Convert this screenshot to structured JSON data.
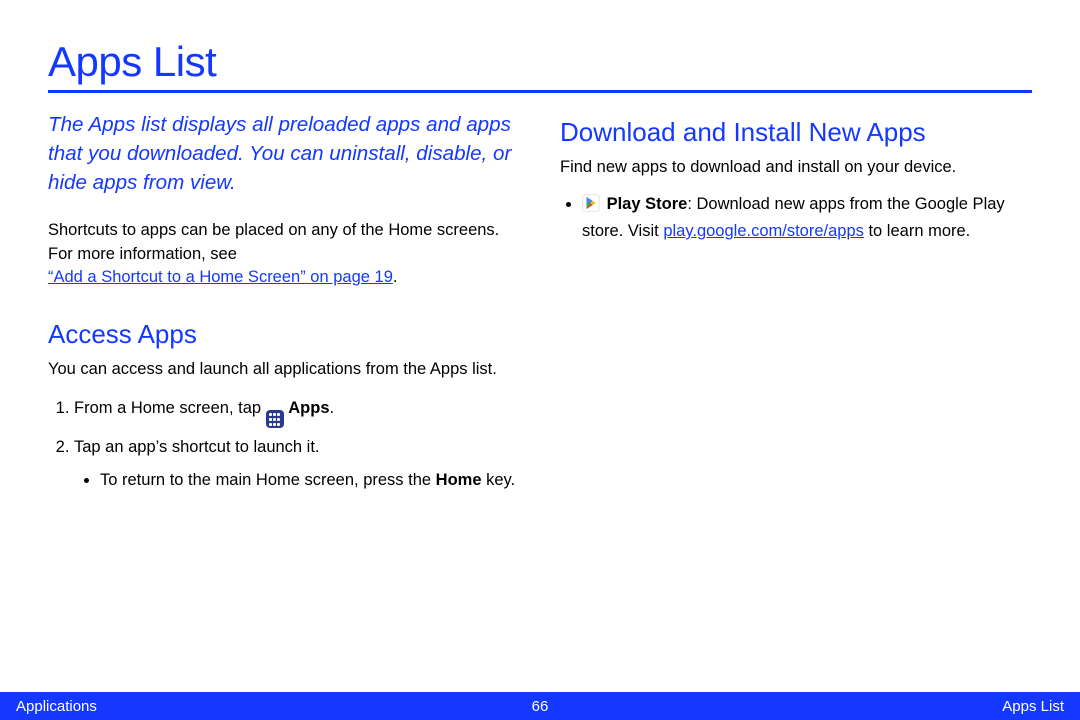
{
  "page_title": "Apps List",
  "left": {
    "intro": "The Apps list displays all preloaded apps and apps that you downloaded. You can uninstall, disable, or hide apps from view.",
    "shortcut_para_1": "Shortcuts to apps can be placed on any of the Home screens. For more information, see",
    "shortcut_crossref": "“Add a Shortcut to a Home Screen” on page 19",
    "shortcut_period": ".",
    "access_heading": "Access Apps",
    "access_intro": "You can access and launch all applications from the Apps list.",
    "step1_pre": "From a Home screen, tap ",
    "step1_bold": "Apps",
    "step1_post": ".",
    "step2": "Tap an app’s shortcut to launch it.",
    "step2_sub_pre": "To return to the main Home screen, press the ",
    "step2_sub_bold": "Home",
    "step2_sub_post": " key."
  },
  "right": {
    "download_heading": "Download and Install New Apps",
    "download_intro": "Find new apps to download and install on your device.",
    "bullet_bold": "Play Store",
    "bullet_text_1": ": Download new apps from the Google Play store. Visit ",
    "bullet_link": "play.google.com/store/apps",
    "bullet_text_2": " to learn more."
  },
  "footer": {
    "left": "Applications",
    "center": "66",
    "right": "Apps List"
  }
}
